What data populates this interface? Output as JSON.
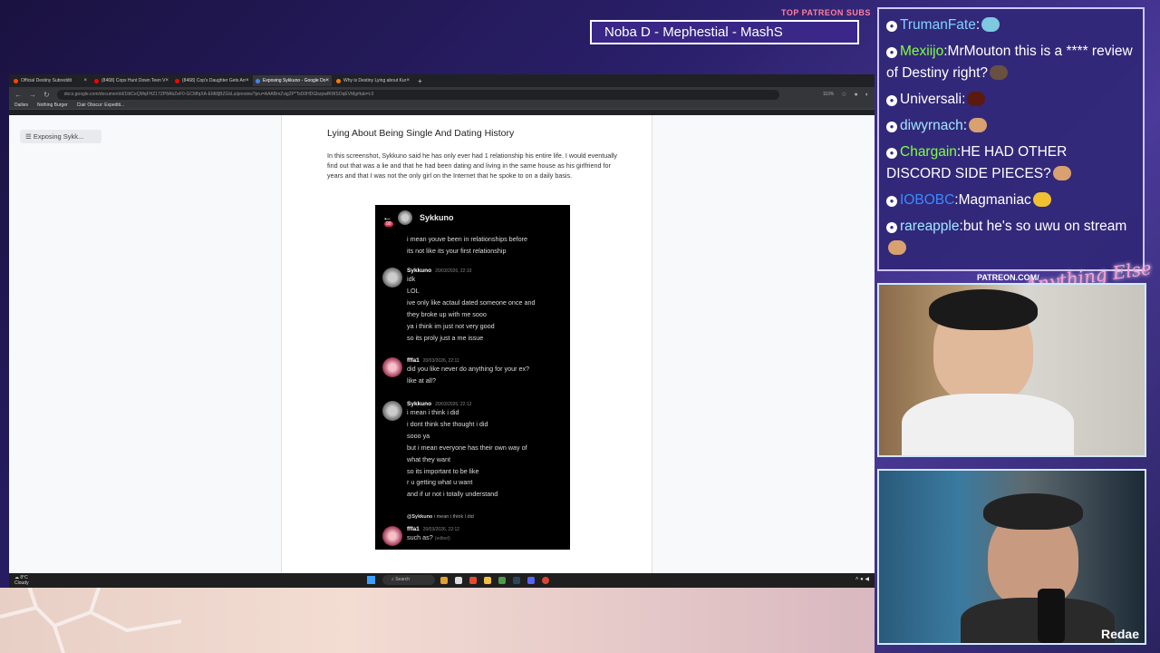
{
  "overlay": {
    "subs_label": "TOP PATREON SUBS",
    "subs_ticker": "Noba D - Mephestial - MashS",
    "patreon_label": "PATREON.COM/",
    "brand_script": "Anything Else",
    "cam2_caption": "Redae"
  },
  "browser": {
    "tabs": [
      {
        "label": "Official Destiny Subreddit",
        "color": "#ff4500"
      },
      {
        "label": "(8468) Cops Hunt Down Teen V",
        "color": "#ff0000"
      },
      {
        "label": "(8468) Cop's Daughter Gets Arr",
        "color": "#ff0000"
      },
      {
        "label": "Exposing Sykkuno - Google Do",
        "color": "#4285f4"
      },
      {
        "label": "Why is Destiny Lying about Kur",
        "color": "#ff7a00"
      }
    ],
    "url": "docs.google.com/document/d/1fdCeQMqFHZ17ZP8AbZeF0-GCMfqXA-EMi8jBZGkLs/preview?pru=AAABmZvig2P*TsD0HDGbzpwfKWSOqEVMg#tab=t.0",
    "zoom": "110%",
    "bookmarks": [
      "Dailies",
      "Nothing Burger",
      "Clair Obscur: Expediti..."
    ]
  },
  "doc": {
    "outline_chip": "Exposing Sykk...",
    "heading": "Lying About Being Single And Dating History",
    "paragraph": "In this screenshot, Sykkuno said he has only ever had 1 relationship his entire life. I would eventually find out that was a lie and that he had been dating and living in the same house as his girlfriend for years and that I was not the only girl on the Internet that he spoke to on a daily basis."
  },
  "discord": {
    "header_name": "Sykkuno",
    "badge": "99",
    "top_lines": [
      "i mean youve been in relationships before",
      "its not like its your first relationship"
    ],
    "messages": [
      {
        "author": "Sykkuno",
        "time": "20/03/2026, 22:10",
        "lines": [
          "idk",
          "LOL",
          "ive only like actaul dated someone once and",
          "they broke up with me sooo",
          "ya i think im just not very good",
          "so its proly just a me issue"
        ]
      },
      {
        "author": "fffa1",
        "time": "20/03/2026, 22:11",
        "lines": [
          "did you like never do anything for your ex?",
          "like at all?"
        ]
      },
      {
        "author": "Sykkuno",
        "time": "20/03/2026, 22:12",
        "lines": [
          "i mean i think i did",
          "i dont think she thought i did",
          "sooo ya",
          "but i mean everyone has their own way of",
          "what they want",
          "so its important to be like",
          "r u getting what u want",
          "and if ur not i totally understand"
        ]
      }
    ],
    "reply_ref_user": "@Sykkuno",
    "reply_ref_text": "i mean i think i did",
    "last": {
      "author": "fffa1",
      "time": "20/03/2026, 22:12",
      "text": "such as?",
      "edited": "(edited)"
    }
  },
  "taskbar": {
    "weather_temp": "8°C",
    "weather_desc": "Cloudy",
    "search": "Search"
  },
  "chat": {
    "messages": [
      {
        "user": "TrumanFate",
        "color": "#7fd4ff",
        "text": "",
        "emote": "#7ec8e0"
      },
      {
        "user": "Mexiijo",
        "color": "#7fff40",
        "text": "MrMouton this is a **** review of Destiny right?",
        "emote": "#6a5040"
      },
      {
        "user": "Universali",
        "color": "#ffffff",
        "text": "",
        "emote": "#5a1a10"
      },
      {
        "user": "diwyrnach",
        "color": "#9fe8ff",
        "text": "",
        "emote": "#d9a070"
      },
      {
        "user": "Chargain",
        "color": "#7fff40",
        "text": "HE HAD OTHER DISCORD SIDE PIECES?",
        "emote": "#d9a070"
      },
      {
        "user": "IOBOBC",
        "color": "#3a8aff",
        "text": "Magmaniac",
        "emote": "#f0c030"
      },
      {
        "user": "rareapple",
        "color": "#9fe8ff",
        "text": "but he's so uwu on stream",
        "emote": "#d9a070"
      }
    ]
  }
}
